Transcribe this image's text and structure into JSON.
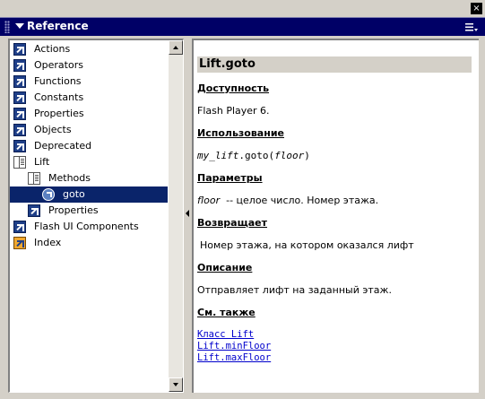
{
  "window": {
    "close_label": "×"
  },
  "panel": {
    "title": "Reference"
  },
  "tree": {
    "items": [
      {
        "label": "Actions",
        "icon": "book-icon"
      },
      {
        "label": "Operators",
        "icon": "book-icon"
      },
      {
        "label": "Functions",
        "icon": "book-icon"
      },
      {
        "label": "Constants",
        "icon": "book-icon"
      },
      {
        "label": "Properties",
        "icon": "book-icon"
      },
      {
        "label": "Objects",
        "icon": "book-icon"
      },
      {
        "label": "Deprecated",
        "icon": "book-icon"
      },
      {
        "label": "Lift",
        "icon": "open-book-icon"
      },
      {
        "label": "Methods",
        "icon": "open-book-icon"
      },
      {
        "label": "goto",
        "icon": "method-icon",
        "selected": true
      },
      {
        "label": "Properties",
        "icon": "book-icon"
      },
      {
        "label": "Flash UI Components",
        "icon": "book-icon"
      },
      {
        "label": "Index",
        "icon": "index-icon"
      }
    ]
  },
  "content": {
    "title": "Lift.goto",
    "availability": {
      "heading": "Доступность",
      "text": "Flash Player 6."
    },
    "usage": {
      "heading": "Использование",
      "object": "my_lift",
      "method": ".goto(",
      "param": "floor",
      "close": ")"
    },
    "params": {
      "heading": "Параметры",
      "name": "floor",
      "desc": "-- целое число. Номер этажа."
    },
    "returns": {
      "heading": "Возвращает",
      "text": "Номер этажа, на котором оказался лифт"
    },
    "description": {
      "heading": "Описание",
      "text": "Отправляет лифт на заданный этаж."
    },
    "see_also": {
      "heading": "См. также",
      "links": [
        "Класс Lift",
        "Lift.minFloor",
        "Lift.maxFloor"
      ]
    }
  },
  "colors": {
    "titlebar": "#000066",
    "selection": "#0a246a",
    "link": "#0000cc",
    "chrome": "#d4d0c8"
  }
}
